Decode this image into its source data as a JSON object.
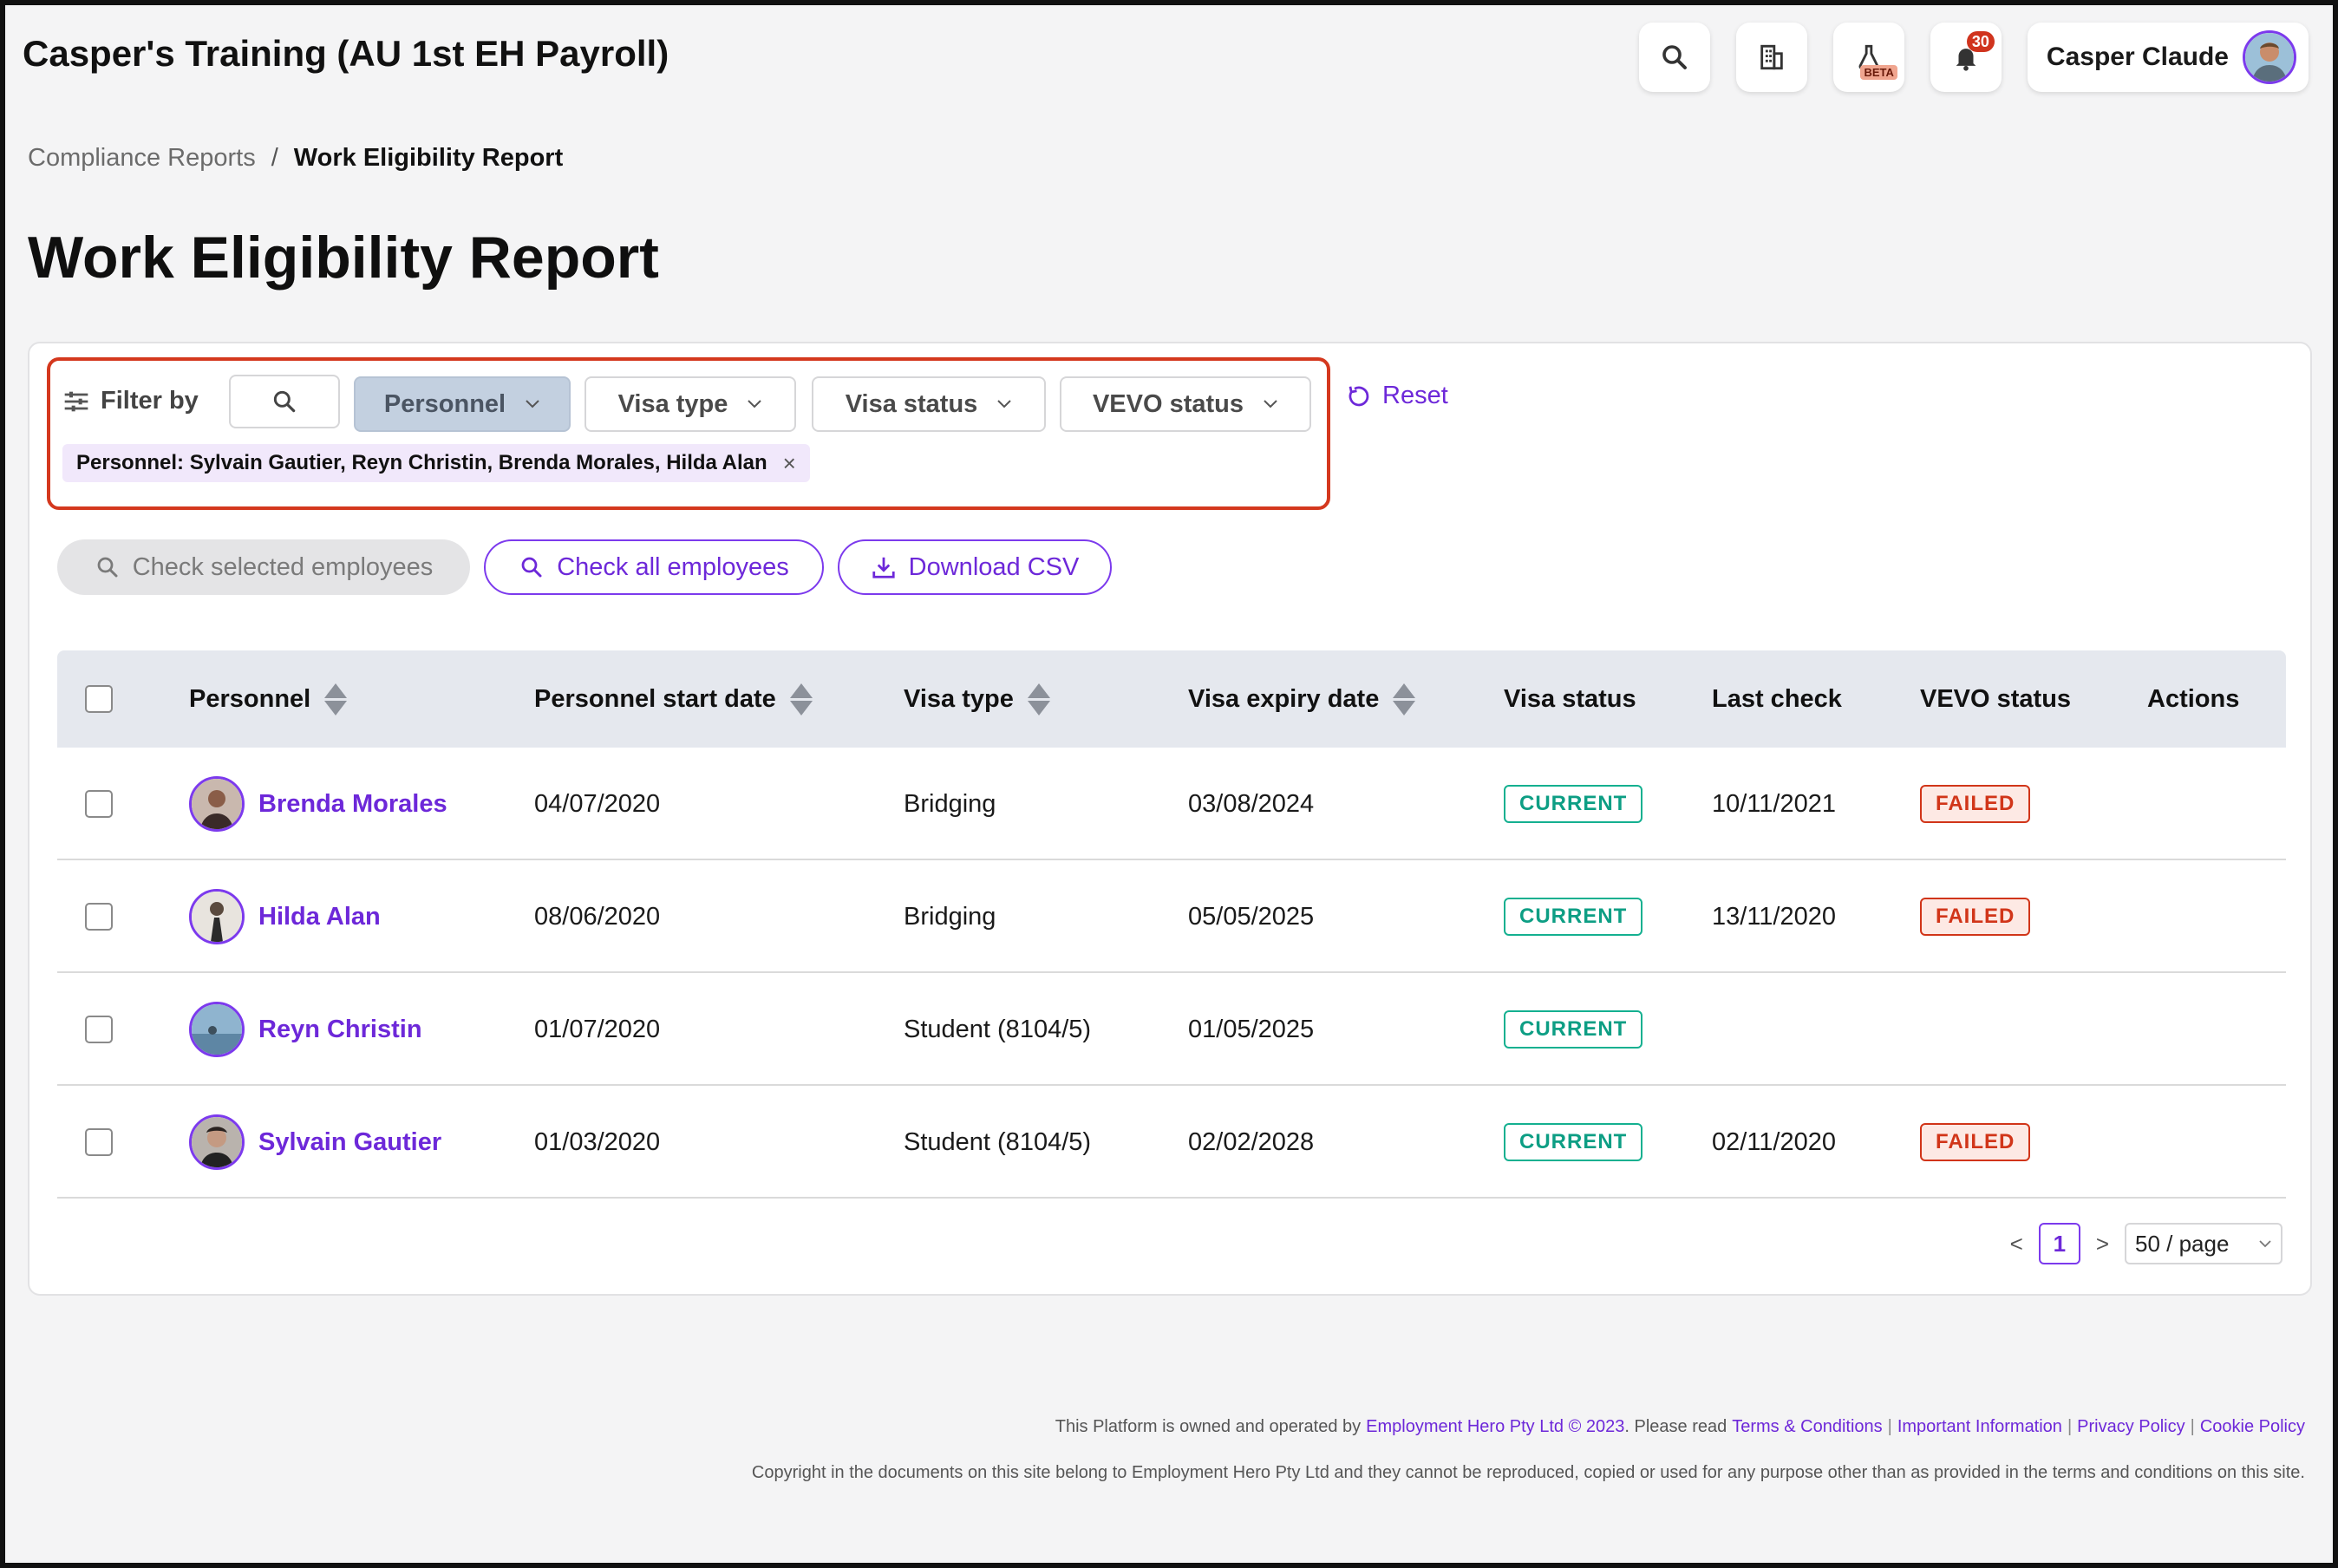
{
  "header": {
    "title": "Casper's Training (AU 1st EH Payroll)",
    "notification_count": "30",
    "beta_label": "BETA",
    "user_name": "Casper Claude"
  },
  "breadcrumb": {
    "parent": "Compliance Reports",
    "separator": "/",
    "current": "Work Eligibility Report"
  },
  "page_title": "Work Eligibility Report",
  "filters": {
    "label": "Filter by",
    "personnel": "Personnel",
    "visa_type": "Visa type",
    "visa_status": "Visa status",
    "vevo_status": "VEVO status",
    "reset": "Reset",
    "active_chip": "Personnel: Sylvain Gautier, Reyn Christin, Brenda Morales, Hilda Alan",
    "chip_remove": "×"
  },
  "actions": {
    "check_selected": "Check selected employees",
    "check_all": "Check all employees",
    "download_csv": "Download CSV"
  },
  "table": {
    "columns": {
      "personnel": "Personnel",
      "start_date": "Personnel start date",
      "visa_type": "Visa type",
      "visa_expiry": "Visa expiry date",
      "visa_status": "Visa status",
      "last_check": "Last check",
      "vevo_status": "VEVO status",
      "actions": "Actions"
    },
    "rows": [
      {
        "name": "Brenda Morales",
        "start_date": "04/07/2020",
        "visa_type": "Bridging",
        "visa_expiry": "03/08/2024",
        "visa_status": "CURRENT",
        "last_check": "10/11/2021",
        "vevo_status": "FAILED"
      },
      {
        "name": "Hilda Alan",
        "start_date": "08/06/2020",
        "visa_type": "Bridging",
        "visa_expiry": "05/05/2025",
        "visa_status": "CURRENT",
        "last_check": "13/11/2020",
        "vevo_status": "FAILED"
      },
      {
        "name": "Reyn Christin",
        "start_date": "01/07/2020",
        "visa_type": "Student (8104/5)",
        "visa_expiry": "01/05/2025",
        "visa_status": "CURRENT",
        "last_check": "",
        "vevo_status": ""
      },
      {
        "name": "Sylvain Gautier",
        "start_date": "01/03/2020",
        "visa_type": "Student (8104/5)",
        "visa_expiry": "02/02/2028",
        "visa_status": "CURRENT",
        "last_check": "02/11/2020",
        "vevo_status": "FAILED"
      }
    ]
  },
  "pagination": {
    "prev": "<",
    "current_page": "1",
    "next": ">",
    "page_size": "50 / page"
  },
  "footer": {
    "line1_prefix": "This Platform is owned and operated by",
    "company_link": "Employment Hero Pty Ltd © 2023",
    "line1_mid": ". Please read",
    "terms": "Terms & Conditions",
    "important": "Important Information",
    "privacy": "Privacy Policy",
    "cookie": "Cookie Policy",
    "divider": "|",
    "copyright": "Copyright in the documents on this site belong to Employment Hero Pty Ltd and they cannot be reproduced, copied or used for any purpose other than as provided in the terms and conditions on this site."
  },
  "colors": {
    "accent": "#6d28d9",
    "highlight_border": "#d4381e",
    "current_badge": "#0d9e84",
    "failed_badge": "#d13519"
  }
}
